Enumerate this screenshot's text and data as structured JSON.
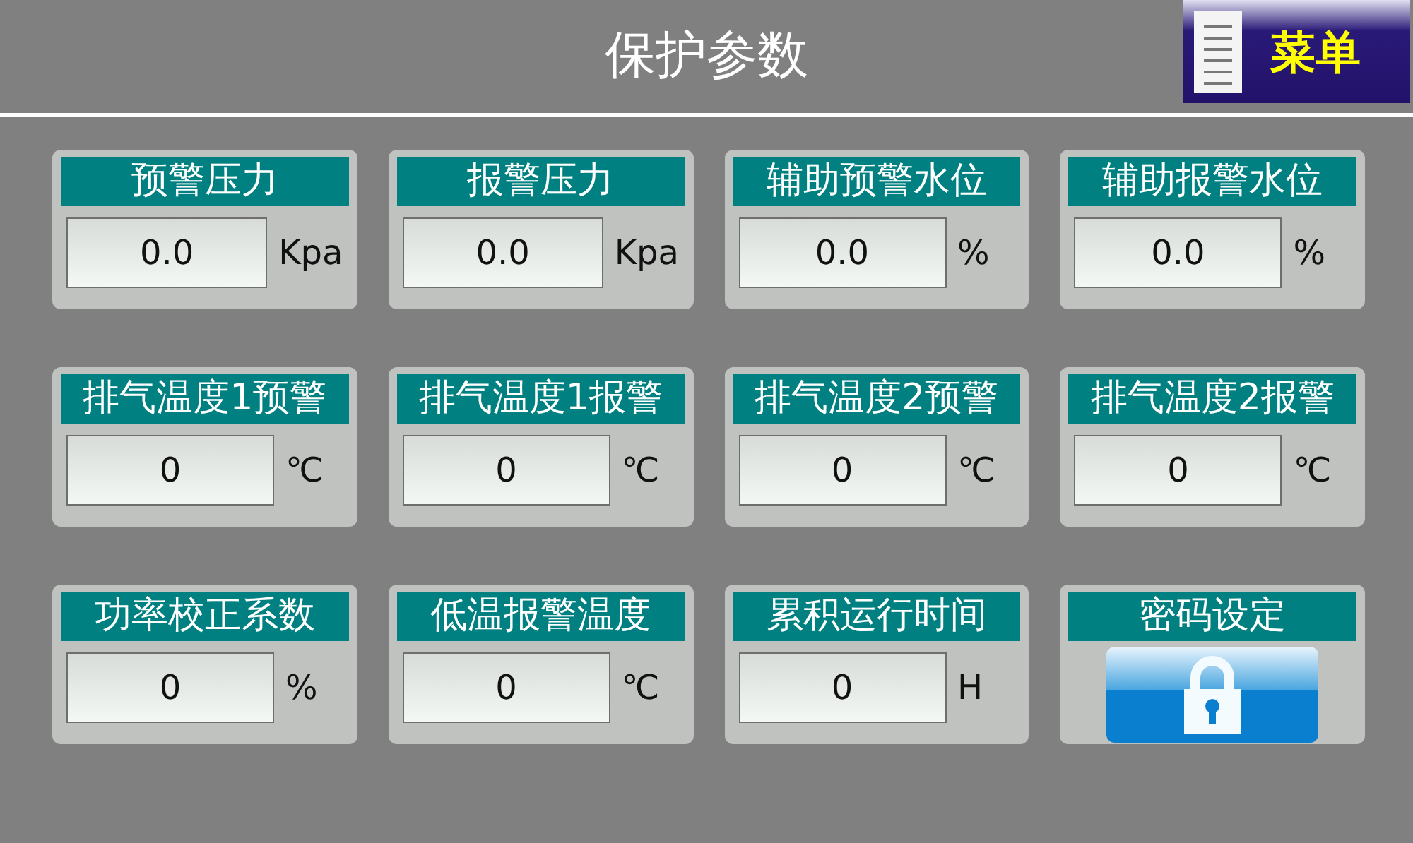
{
  "header": {
    "title": "保护参数",
    "menu_button": "菜单"
  },
  "cards": [
    {
      "kind": "field",
      "title": "预警压力",
      "value": "0.0",
      "unit": "Kpa"
    },
    {
      "kind": "field",
      "title": "报警压力",
      "value": "0.0",
      "unit": "Kpa"
    },
    {
      "kind": "field",
      "title": "辅助预警水位",
      "value": "0.0",
      "unit": "%"
    },
    {
      "kind": "field",
      "title": "辅助报警水位",
      "value": "0.0",
      "unit": "%"
    },
    {
      "kind": "field",
      "title": "排气温度1预警",
      "value": "0",
      "unit": "℃"
    },
    {
      "kind": "field",
      "title": "排气温度1报警",
      "value": "0",
      "unit": "℃"
    },
    {
      "kind": "field",
      "title": "排气温度2预警",
      "value": "0",
      "unit": "℃"
    },
    {
      "kind": "field",
      "title": "排气温度2报警",
      "value": "0",
      "unit": "℃"
    },
    {
      "kind": "field",
      "title": "功率校正系数",
      "value": "0",
      "unit": "%"
    },
    {
      "kind": "field",
      "title": "低温报警温度",
      "value": "0",
      "unit": "℃"
    },
    {
      "kind": "field",
      "title": "累积运行时间",
      "value": "0",
      "unit": "H"
    },
    {
      "kind": "lock",
      "title": "密码设定"
    }
  ]
}
